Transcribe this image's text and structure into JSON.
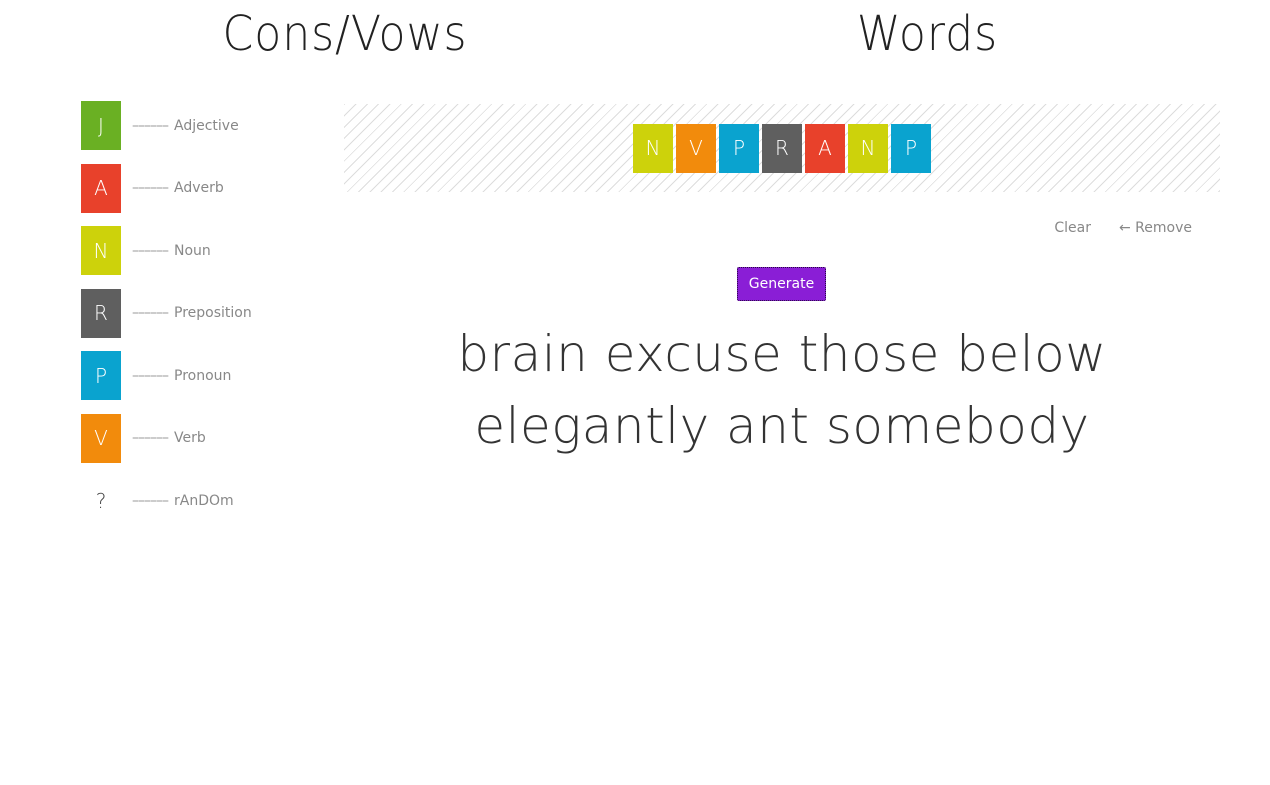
{
  "headings": {
    "left": "Cons/Vows",
    "right": "Words"
  },
  "legend": [
    {
      "letter": "J",
      "label": "Adjective",
      "color": "#6ab023",
      "dash": "––––––"
    },
    {
      "letter": "A",
      "label": "Adverb",
      "color": "#e8412b",
      "dash": "––––––"
    },
    {
      "letter": "N",
      "label": "Noun",
      "color": "#cdd20b",
      "dash": "––––––"
    },
    {
      "letter": "R",
      "label": "Preposition",
      "color": "#5f5f5f",
      "dash": "––––––"
    },
    {
      "letter": "P",
      "label": "Pronoun",
      "color": "#0aa3cf",
      "dash": "––––––"
    },
    {
      "letter": "V",
      "label": "Verb",
      "color": "#f28b0c",
      "dash": "––––––"
    },
    {
      "letter": "?",
      "label": "rAnDOm",
      "color": "",
      "dash": "––––––"
    }
  ],
  "sequence": [
    {
      "letter": "N",
      "color": "#cdd20b"
    },
    {
      "letter": "V",
      "color": "#f28b0c"
    },
    {
      "letter": "P",
      "color": "#0aa3cf"
    },
    {
      "letter": "R",
      "color": "#5f5f5f"
    },
    {
      "letter": "A",
      "color": "#e8412b"
    },
    {
      "letter": "N",
      "color": "#cdd20b"
    },
    {
      "letter": "P",
      "color": "#0aa3cf"
    }
  ],
  "actions": {
    "clear": "Clear",
    "remove": "← Remove"
  },
  "generate_label": "Generate",
  "generate_color": "#8a1ed6",
  "sentence": "brain excuse those below elegantly ant somebody"
}
